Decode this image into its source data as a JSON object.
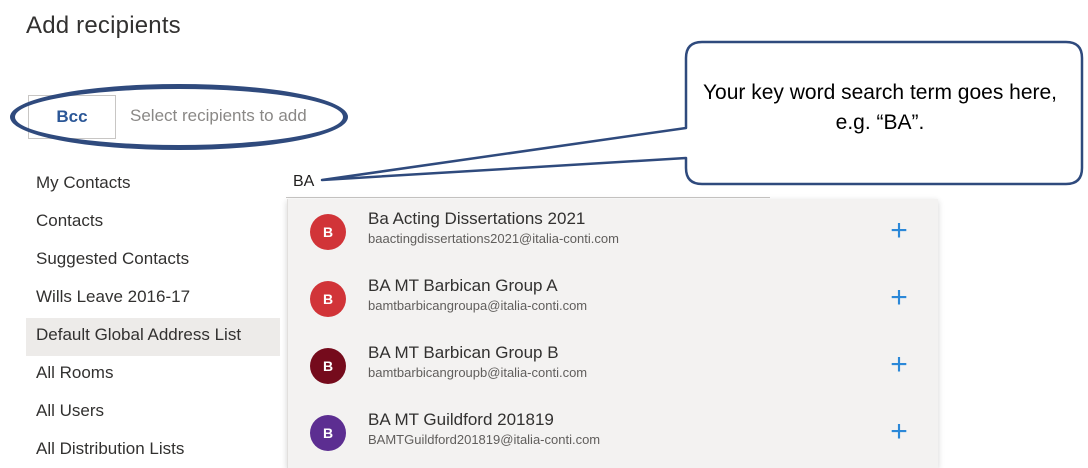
{
  "dialog": {
    "title": "Add recipients"
  },
  "recipient_field": {
    "type_label": "Bcc",
    "placeholder": "Select recipients to add"
  },
  "address_lists": [
    {
      "label": "My Contacts",
      "selected": false
    },
    {
      "label": "Contacts",
      "selected": false
    },
    {
      "label": "Suggested Contacts",
      "selected": false
    },
    {
      "label": "Wills Leave 2016-17",
      "selected": false
    },
    {
      "label": "Default Global Address List",
      "selected": true
    },
    {
      "label": "All Rooms",
      "selected": false
    },
    {
      "label": "All Users",
      "selected": false
    },
    {
      "label": "All Distribution Lists",
      "selected": false
    }
  ],
  "search": {
    "value": "BA"
  },
  "results": [
    {
      "initial": "B",
      "name": "Ba Acting Dissertations 2021",
      "email": "baactingdissertations2021@italia-conti.com",
      "avatar_color": "#d13438",
      "add_icon": "+"
    },
    {
      "initial": "B",
      "name": "BA MT Barbican Group A",
      "email": "bamtbarbicangroupa@italia-conti.com",
      "avatar_color": "#d13438",
      "add_icon": "+"
    },
    {
      "initial": "B",
      "name": "BA MT Barbican Group B",
      "email": "bamtbarbicangroupb@italia-conti.com",
      "avatar_color": "#750b1c",
      "add_icon": "+"
    },
    {
      "initial": "B",
      "name": "BA MT Guildford 201819",
      "email": "BAMTGuildford201819@italia-conti.com",
      "avatar_color": "#5c2e91",
      "add_icon": "+"
    }
  ],
  "callout": {
    "text": "Your key word search term goes here, e.g. “BA”."
  },
  "colors": {
    "accent": "#2b88d8",
    "highlight_ring": "#2f4a7d",
    "callout_border": "#2f4a7d"
  }
}
